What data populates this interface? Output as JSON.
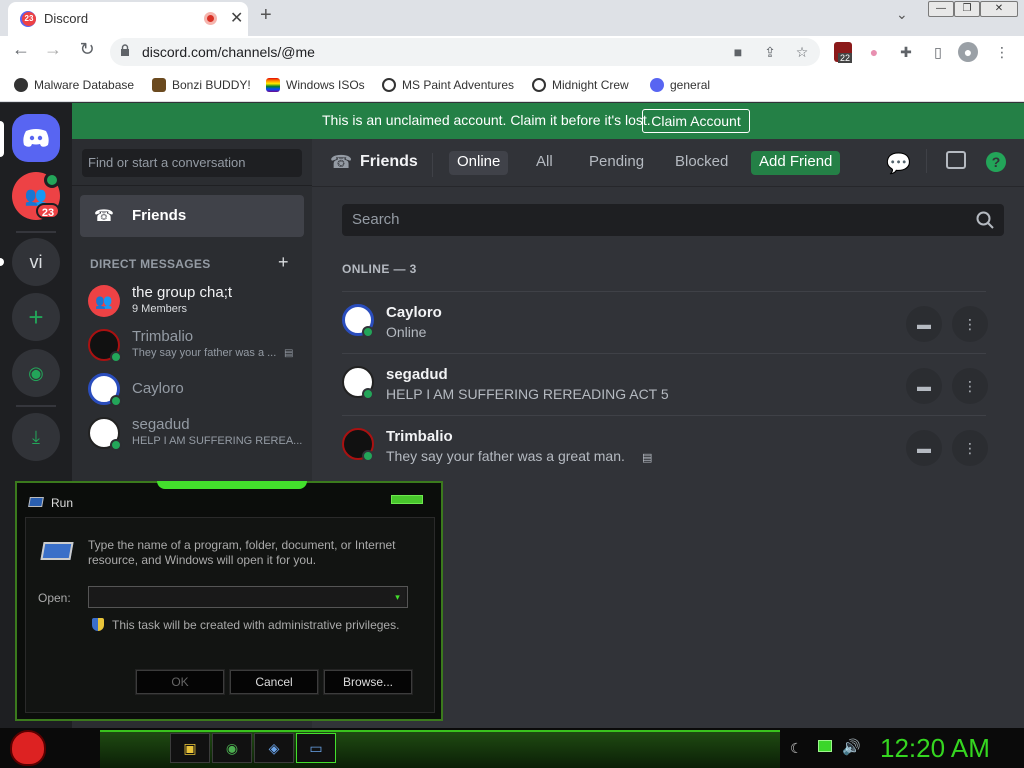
{
  "browser": {
    "tab_title": "Discord",
    "tab_badge": "23",
    "url": "discord.com/channels/@me",
    "ext_badge": "22",
    "bookmarks": [
      "Malware Database",
      "Bonzi BUDDY!",
      "Windows ISOs",
      "MS Paint Adventures",
      "Midnight Crew",
      "general"
    ]
  },
  "servers": {
    "badge": "23",
    "vi_label": "vi"
  },
  "banner": {
    "text": "This is an unclaimed account. Claim it before it's lost.",
    "button": "Claim Account"
  },
  "dm": {
    "search_placeholder": "Find or start a conversation",
    "friends_label": "Friends",
    "header": "DIRECT MESSAGES",
    "rows": [
      {
        "name": "the group cha;t",
        "sub": "9 Members"
      },
      {
        "name": "Trimbalio",
        "sub": "They say your father was a ..."
      },
      {
        "name": "Cayloro",
        "sub": ""
      },
      {
        "name": "segadud",
        "sub": "HELP I AM SUFFERING REREA..."
      }
    ]
  },
  "friends": {
    "title": "Friends",
    "tabs": [
      "Online",
      "All",
      "Pending",
      "Blocked"
    ],
    "add_friend": "Add Friend",
    "search_placeholder": "Search",
    "online_header": "ONLINE — 3",
    "list": [
      {
        "name": "Cayloro",
        "status": "Online"
      },
      {
        "name": "segadud",
        "status": "HELP I AM SUFFERING REREADING ACT 5"
      },
      {
        "name": "Trimbalio",
        "status": "They say your father was a great man."
      }
    ]
  },
  "run_dialog": {
    "title": "Run",
    "description": "Type the name of a program, folder, document, or Internet resource, and Windows will open it for you.",
    "open_label": "Open:",
    "input_value": "",
    "admin_note": "This task will be created with administrative privileges.",
    "ok": "OK",
    "cancel": "Cancel",
    "browse": "Browse..."
  },
  "taskbar": {
    "clock": "12:20 AM"
  },
  "colors": {
    "discord_blurple": "#5865f2",
    "discord_green": "#248046",
    "online_green": "#23a559",
    "taskbar_green": "#35d620"
  }
}
